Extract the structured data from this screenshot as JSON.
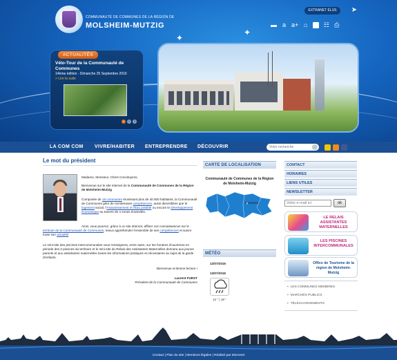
{
  "header": {
    "logo_subtitle": "COMMUNAUTÉ DE COMMUNES DE LA RÉGION DE",
    "logo_name": "MOLSHEIM-MUTZIG",
    "extranet_label": "EXTRANET ÉLUS",
    "toolbar": {
      "font_smaller": "a",
      "font_larger": "a+"
    }
  },
  "slider": {
    "badge": "ACTUALITÉS",
    "title": "Vélo-Tour de la Communauté de Communes",
    "date": "14ème édition - Dimanche 25 Septembre 2016",
    "more": "> Lire la suite",
    "pages": [
      "1",
      "2",
      "3"
    ]
  },
  "nav": {
    "items": [
      "LA COM COM",
      "VIVRE/HABITER",
      "ENTREPRENDRE",
      "DÉCOUVRIR"
    ],
    "search_placeholder": "Votre recherche"
  },
  "editorial": {
    "title": "Le mot du président",
    "greeting": "Madame, Monsieur, Chers Concitoyens,",
    "intro_pre": "Bienvenue sur le site internet de la ",
    "intro_bold": "Communauté de Communes de la Région de Molsheim-Mutzig",
    "body_1": "Composée de ",
    "body_link_1": "18 communes",
    "body_2": " réunissant plus de 40.000 habitants, la Communauté de Communes gère de nombreuses ",
    "body_link_2": "compétences",
    "body_3": ", aussi diversifiées que le ",
    "body_link_3": "logement",
    "body_4": " social, l'",
    "body_link_4": "Assainissement et l'Eau potable",
    "body_5": " ou encore le ",
    "body_link_5": "Développement économique",
    "body_6": " au travers de 4 zones d'activités.",
    "reach_1": "Ainsi, vous pourrez, grâce à ce site internet, affiner vos connaissances sur le ",
    "reach_link_1": "territoire de la Communauté de Communes",
    "reach_2": ", mieux appréhender l'ensemble de ses ",
    "reach_link_2": "compétences",
    "reach_3": " et suivre toute son ",
    "reach_link_3": "actualité",
    "pool": "Le mini-site des piscines intercommunales vous renseignera, entre autre, sur les horaires d'ouverture en période des 3 piscines du territoire et le mini-site du Relais des Assistantes Maternelles donnera aux jeunes parents et aux assistantes maternelles toutes les informations pratiques et nécessaires au sujet de la garde d'enfants.",
    "bye": "Bienvenue et Bonne lecture !",
    "signature": "Laurent FURST",
    "role": "Président de la Communauté de Communes"
  },
  "map_box": {
    "heading": "CARTE DE LOCALISATION",
    "title": "Communauté de Communes de la Région de Molsheim-Mutzig",
    "city": "Molsheim"
  },
  "weather": {
    "heading": "MÉTÉO",
    "date_1": "12/07/2016",
    "date_2": "13/07/2016",
    "icon": "rain-cloud-icon",
    "temps": "12 ° | 18 °"
  },
  "quick_links": [
    "CONTACT",
    "HORAIRES",
    "LIENS UTILES",
    "NEWSLETTER"
  ],
  "newsletter": {
    "placeholder": "Votre e-mail ici",
    "button": "ok"
  },
  "promos": {
    "relais": "LE RELAIS ASSISTANTES MATERNELLES",
    "piscines": "LES PISCINES INTERCOMMUNALES",
    "tourisme": "Office de Tourisme de la région de Molsheim-Mutzig"
  },
  "links": [
    "LES COMMUNES MEMBRES",
    "MARCHÉS PUBLICS",
    "TÉLÉCHARGEMENTS"
  ],
  "footer": {
    "text": "Contact | Plan du site | Mentions légales | Réalisé par Micronet"
  },
  "colors": {
    "brand_blue": "#1b4f93",
    "accent_orange": "#e0701e",
    "accent_pink": "#c0267c"
  }
}
